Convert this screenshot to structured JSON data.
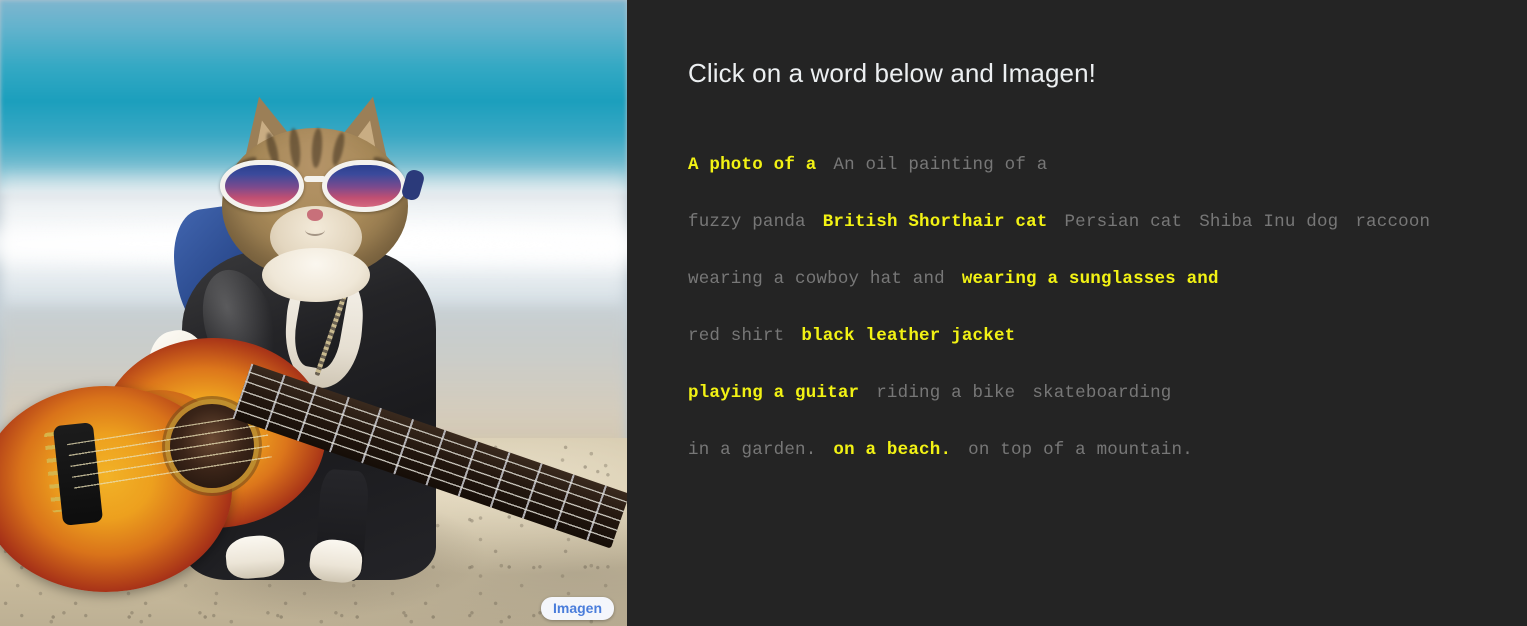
{
  "panel": {
    "title": "Click on a word below and Imagen!",
    "background_color": "#242424",
    "active_color": "#f2f214",
    "inactive_color": "#777777"
  },
  "image": {
    "badge_label": "Imagen",
    "badge_text_color": "#4a7ddb",
    "description": "A photo of a British Shorthair cat wearing sunglasses and a black leather jacket playing a guitar on a beach.",
    "scene": {
      "ocean_color": "#1b9fbd",
      "sand_color": "#d8cbad",
      "guitar_body_color": "#eda01e",
      "guitar_edge_color": "#751414",
      "jacket_color": "#1b1b1e",
      "collar_color": "#2c4c90"
    }
  },
  "prompt_rows": [
    {
      "name": "style",
      "options": [
        {
          "label": "A photo of a",
          "selected": true
        },
        {
          "label": "An oil painting of a",
          "selected": false
        }
      ]
    },
    {
      "name": "subject",
      "options": [
        {
          "label": "fuzzy panda",
          "selected": false
        },
        {
          "label": "British Shorthair cat",
          "selected": true
        },
        {
          "label": "Persian cat",
          "selected": false
        },
        {
          "label": "Shiba Inu dog",
          "selected": false
        },
        {
          "label": "raccoon",
          "selected": false
        }
      ]
    },
    {
      "name": "headwear",
      "options": [
        {
          "label": "wearing a cowboy hat and",
          "selected": false
        },
        {
          "label": "wearing a sunglasses and",
          "selected": true
        }
      ]
    },
    {
      "name": "clothing",
      "options": [
        {
          "label": "red shirt",
          "selected": false
        },
        {
          "label": "black leather jacket",
          "selected": true
        }
      ]
    },
    {
      "name": "activity",
      "options": [
        {
          "label": "playing a guitar",
          "selected": true
        },
        {
          "label": "riding a bike",
          "selected": false
        },
        {
          "label": "skateboarding",
          "selected": false
        }
      ]
    },
    {
      "name": "location",
      "options": [
        {
          "label": "in a garden.",
          "selected": false
        },
        {
          "label": "on a beach.",
          "selected": true
        },
        {
          "label": "on top of a mountain.",
          "selected": false
        }
      ]
    }
  ]
}
